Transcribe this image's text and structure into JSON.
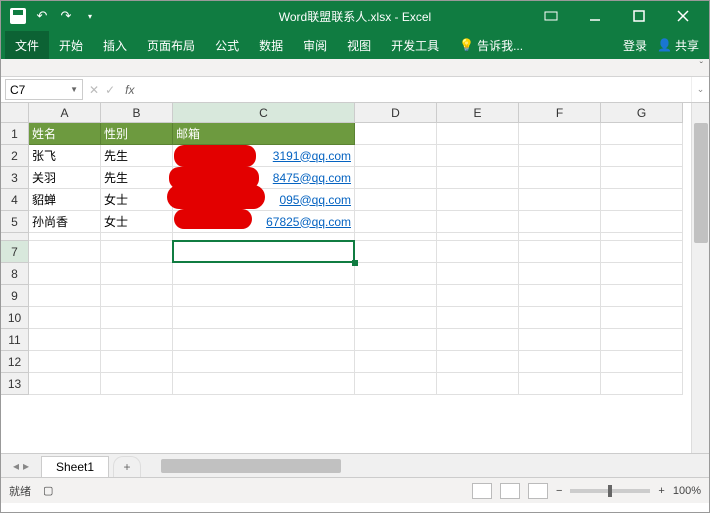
{
  "titlebar": {
    "title": "Word联盟联系人.xlsx - Excel"
  },
  "tabs": {
    "file": "文件",
    "home": "开始",
    "insert": "插入",
    "layout": "页面布局",
    "formulas": "公式",
    "data": "数据",
    "review": "审阅",
    "view": "视图",
    "dev": "开发工具",
    "tell": "告诉我...",
    "login": "登录",
    "share": "共享"
  },
  "namebox": {
    "value": "C7"
  },
  "fx": {
    "label": "fx"
  },
  "grid": {
    "cols": [
      "A",
      "B",
      "C",
      "D",
      "E",
      "F",
      "G"
    ],
    "header": {
      "a": "姓名",
      "b": "性别",
      "c": "邮箱"
    },
    "rows": [
      {
        "a": "张飞",
        "b": "先生",
        "c": "3191@qq.com"
      },
      {
        "a": "关羽",
        "b": "先生",
        "c": "8475@qq.com"
      },
      {
        "a": "貂蝉",
        "b": "女士",
        "c": "095@qq.com"
      },
      {
        "a": "孙尚香",
        "b": "女士",
        "c": "67825@qq.com"
      }
    ]
  },
  "sheet": {
    "name": "Sheet1",
    "add": "+"
  },
  "status": {
    "ready": "就绪",
    "zoom": "100%",
    "minus": "−",
    "plus": "+"
  },
  "colWidths": {
    "A": 72,
    "B": 72,
    "C": 182,
    "D": 82,
    "E": 82,
    "F": 82,
    "G": 82
  }
}
